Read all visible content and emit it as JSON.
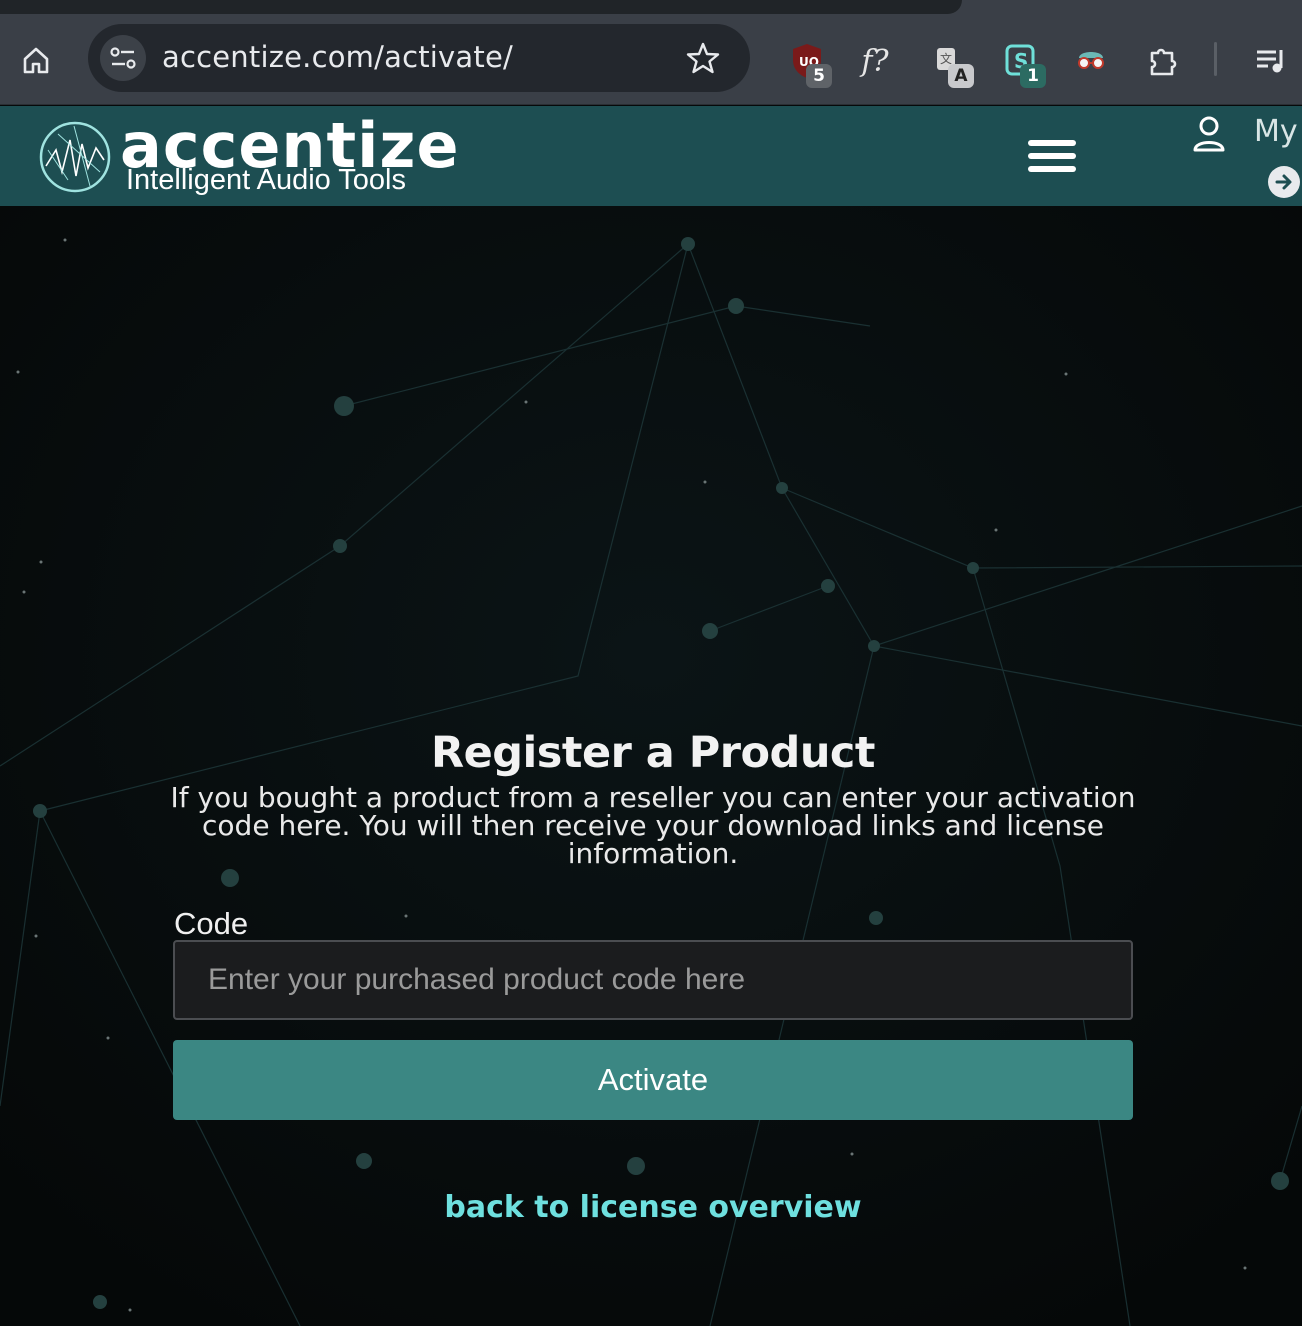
{
  "browser": {
    "url": "accentize.com/activate/",
    "extensions": [
      {
        "name": "ublock-origin",
        "badge": "5"
      },
      {
        "name": "font-identifier",
        "label": "f?"
      },
      {
        "name": "translate-extension",
        "badge": "A"
      },
      {
        "name": "stylus-extension",
        "badge": "1"
      },
      {
        "name": "spy-glasses-extension"
      },
      {
        "name": "extensions-puzzle"
      },
      {
        "name": "media-queue"
      }
    ]
  },
  "header": {
    "brand": "accentize",
    "tagline": "Intelligent Audio Tools",
    "account_label": "My"
  },
  "main": {
    "title": "Register a Product",
    "description": "If you bought a product from a reseller you can enter your activation code here. You will then receive your download links and license information.",
    "code_label": "Code",
    "code_placeholder": "Enter your purchased product code here",
    "code_value": "",
    "activate_label": "Activate",
    "back_link": "back to license overview"
  },
  "colors": {
    "header_bg": "#1d4e52",
    "button_bg": "#3b8783",
    "link": "#6ee0df",
    "page_bg": "#06090a"
  }
}
